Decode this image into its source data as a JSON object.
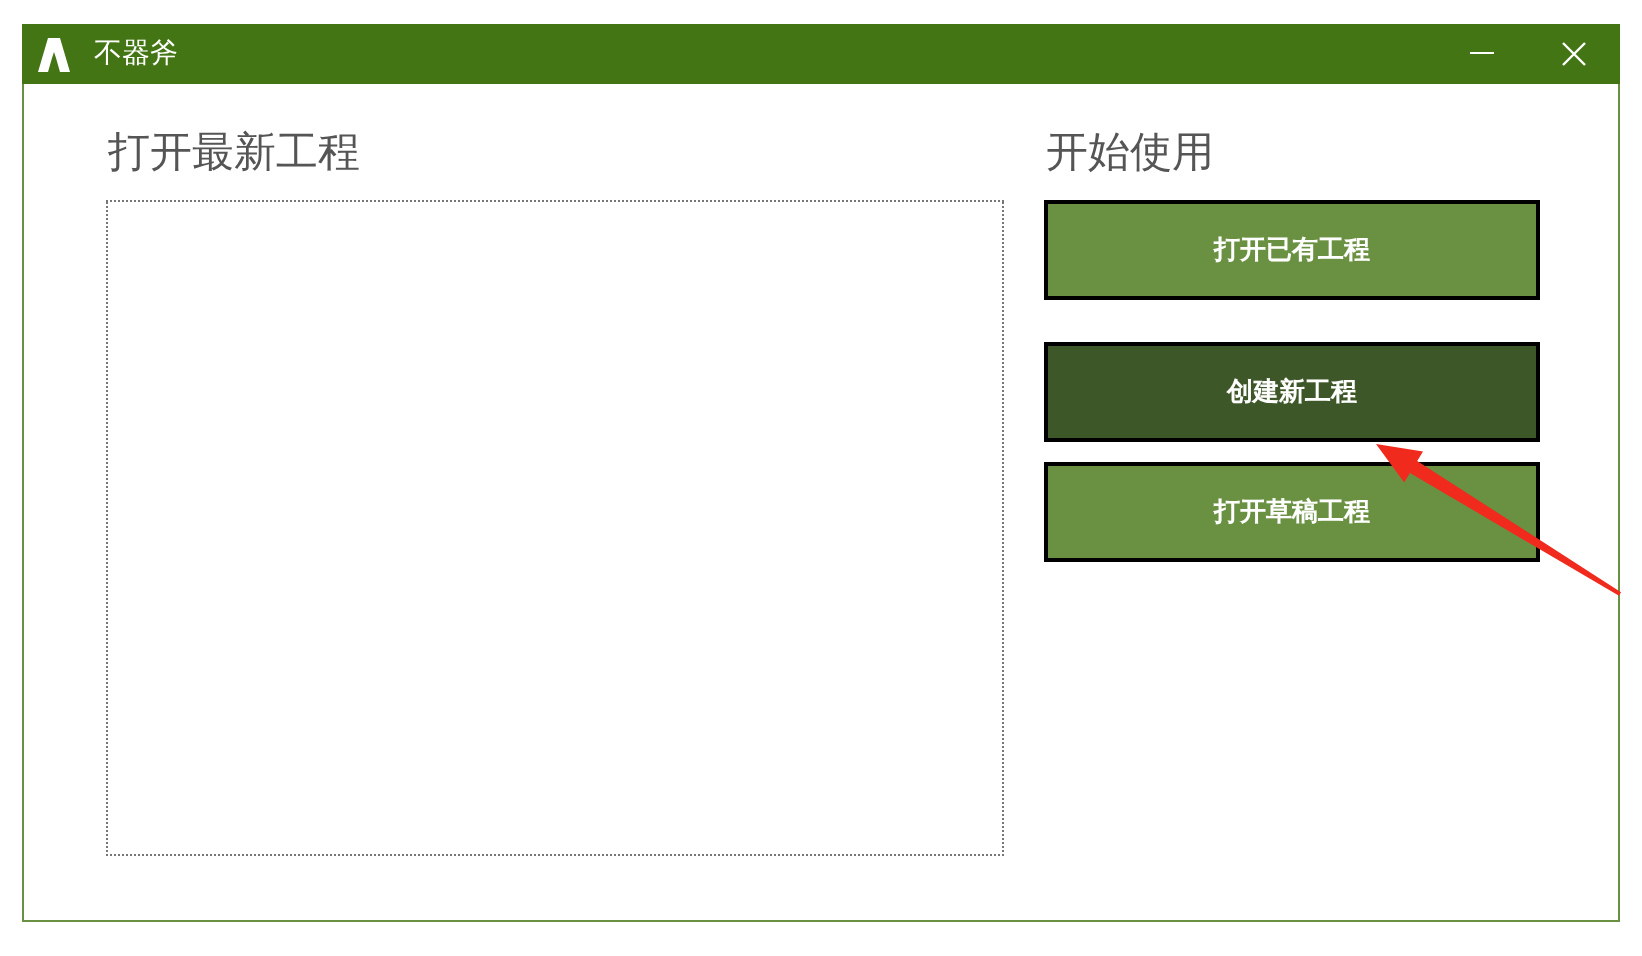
{
  "window": {
    "title": "不器斧"
  },
  "recent": {
    "heading": "打开最新工程"
  },
  "start": {
    "heading": "开始使用",
    "buttons": [
      {
        "label": "打开已有工程",
        "hovered": false
      },
      {
        "label": "创建新工程",
        "hovered": true
      },
      {
        "label": "打开草稿工程",
        "hovered": false
      }
    ]
  }
}
